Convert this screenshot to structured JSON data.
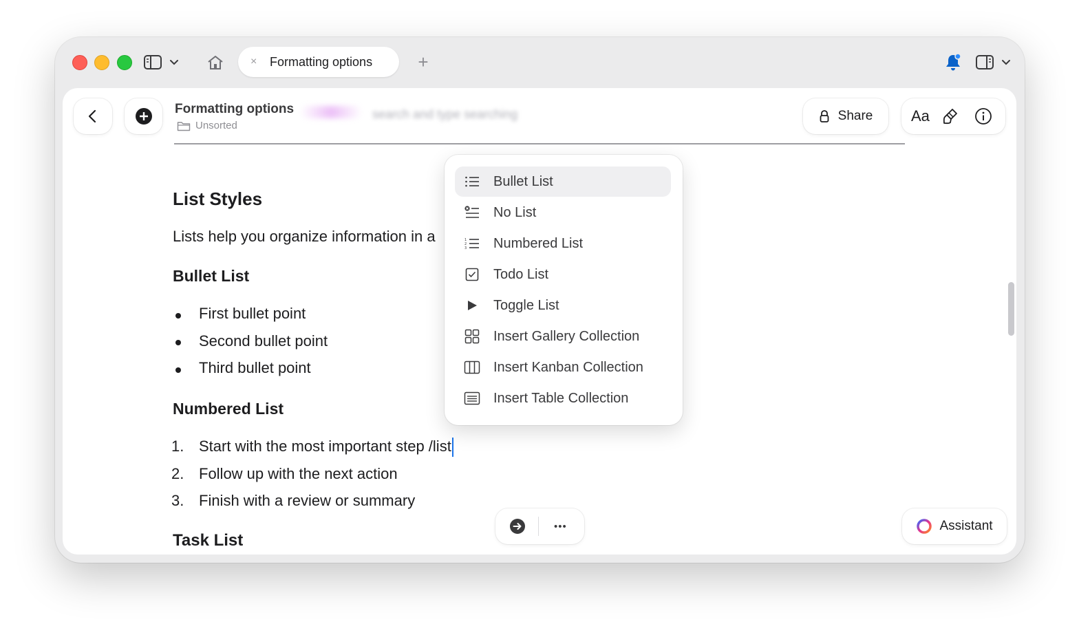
{
  "tab": {
    "title": "Formatting options",
    "close_icon": "×"
  },
  "toolbar": {
    "new_tab_label": "+"
  },
  "document": {
    "title": "Formatting options",
    "folder": "Unsorted",
    "blurred_snippet": "search and type searching"
  },
  "header_actions": {
    "share_label": "Share",
    "text_style_label": "Aa"
  },
  "content": {
    "heading_list_styles": "List Styles",
    "intro": "Lists help you organize information in a",
    "heading_bullet": "Bullet List",
    "bullets": [
      "First bullet point",
      "Second bullet point",
      "Third bullet point"
    ],
    "heading_numbered": "Numbered List",
    "numbered": [
      {
        "marker": "1.",
        "text": "Start with the most important step /list"
      },
      {
        "marker": "2.",
        "text": "Follow up with the next action"
      },
      {
        "marker": "3.",
        "text": "Finish with a review or summary"
      }
    ],
    "heading_task": "Task List"
  },
  "slash_menu": {
    "items": [
      {
        "label": "Bullet List",
        "icon": "bullet-list-icon",
        "selected": true
      },
      {
        "label": "No List",
        "icon": "no-list-icon"
      },
      {
        "label": "Numbered List",
        "icon": "numbered-list-icon"
      },
      {
        "label": "Todo List",
        "icon": "todo-list-icon"
      },
      {
        "label": "Toggle List",
        "icon": "toggle-list-icon"
      },
      {
        "label": "Insert Gallery Collection",
        "icon": "gallery-collection-icon"
      },
      {
        "label": "Insert Kanban Collection",
        "icon": "kanban-collection-icon"
      },
      {
        "label": "Insert Table Collection",
        "icon": "table-collection-icon"
      }
    ]
  },
  "bottom_bar": {
    "more_label": "•••"
  },
  "assistant": {
    "label": "Assistant"
  },
  "colors": {
    "accent_caret": "#1a73e8",
    "notification_blue": "#0a62c9"
  }
}
